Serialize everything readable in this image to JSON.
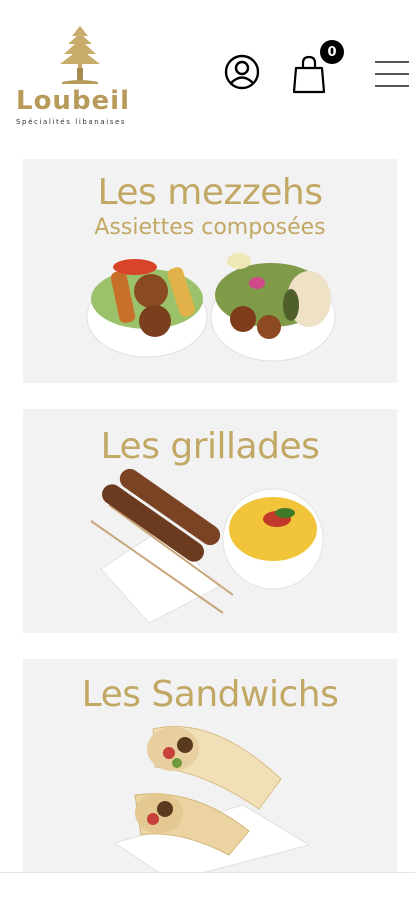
{
  "brand": {
    "name": "Loubeil",
    "wordmark": "Loubeil",
    "tagline": "Spécialités libanaises",
    "color": "#b89a5a"
  },
  "header": {
    "cart_count": "0",
    "icons": [
      "user-icon",
      "shopping-bag-icon",
      "hamburger-menu-icon"
    ]
  },
  "theme": {
    "accent": "#c2a865",
    "card_bg": "#f2f2f2"
  },
  "categories": [
    {
      "title": "Les mezzehs",
      "subtitle": "Assiettes composées"
    },
    {
      "title": "Les grillades",
      "subtitle": ""
    },
    {
      "title": "Les Sandwichs",
      "subtitle": ""
    }
  ]
}
